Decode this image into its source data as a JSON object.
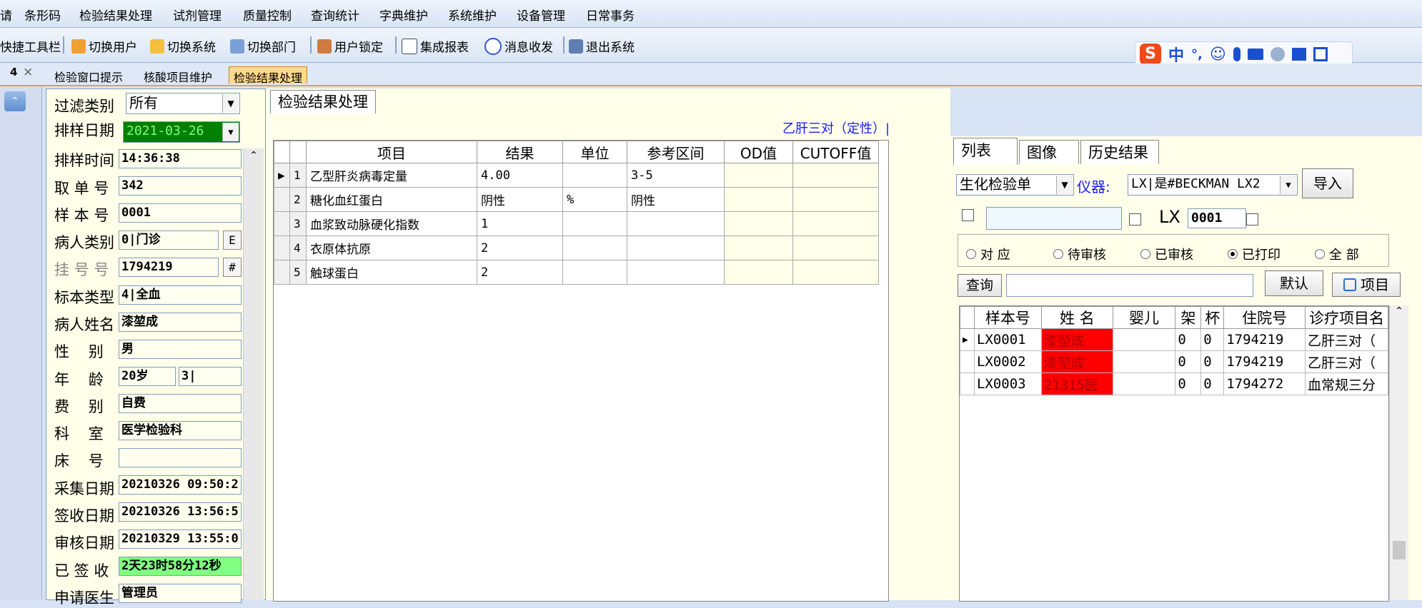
{
  "menu": [
    "请",
    "条形码",
    "检验结果处理",
    "试剂管理",
    "质量控制",
    "查询统计",
    "字典维护",
    "系统维护",
    "设备管理",
    "日常事务"
  ],
  "toolbar": {
    "quick": "快捷工具栏",
    "switch_user": "切换用户",
    "switch_system": "切换系统",
    "switch_dept": "切换部门",
    "user_lock": "用户锁定",
    "report": "集成报表",
    "message": "消息收发",
    "exit": "退出系统"
  },
  "ime": {
    "logo": "S",
    "mode": "中",
    "punct": "°,"
  },
  "doc_tabs": [
    "检验窗口提示",
    "核酸项目维护",
    "检验结果处理"
  ],
  "pin": "4",
  "close": "×",
  "left": {
    "filter_label": "过滤类别",
    "filter_value": "所有",
    "date_label": "排样日期",
    "date_value": "2021-03-26",
    "fields": [
      {
        "label": "排样时间",
        "value": "14:36:38"
      },
      {
        "label": "取 单 号",
        "value": "342"
      },
      {
        "label": "样 本 号",
        "value": "0001"
      },
      {
        "label": "病人类别",
        "value": "0|门诊"
      },
      {
        "label": "挂 号 号",
        "value": "1794219"
      },
      {
        "label": "标本类型",
        "value": "4|全血"
      },
      {
        "label": "病人姓名",
        "value": "漆堃成"
      },
      {
        "label": "性    别",
        "value": "男"
      },
      {
        "label": "年    龄",
        "value": "20岁"
      },
      {
        "label": "费    别",
        "value": "自费"
      },
      {
        "label": "科    室",
        "value": "医学检验科"
      },
      {
        "label": "床    号",
        "value": ""
      },
      {
        "label": "采集日期",
        "value": "20210326 09:50:2"
      },
      {
        "label": "签收日期",
        "value": "20210326 13:56:5"
      },
      {
        "label": "审核日期",
        "value": "20210329 13:55:0"
      },
      {
        "label": "已 签 收",
        "value": "2天23时58分12秒"
      },
      {
        "label": "申请医生",
        "value": "管理员"
      }
    ],
    "age_unit_value": "3|",
    "btn_e": "E",
    "btn_hash": "#"
  },
  "center": {
    "tab": "检验结果处理",
    "title": "乙肝三对（定性）|",
    "columns": [
      "项目",
      "结果",
      "单位",
      "参考区间",
      "OD值",
      "CUTOFF值"
    ],
    "rows": [
      {
        "no": "1",
        "item": "乙型肝炎病毒定量",
        "result": "4.00",
        "unit": "",
        "range": "3-5",
        "od": "",
        "cutoff": ""
      },
      {
        "no": "2",
        "item": "糖化血红蛋白",
        "result": "阴性",
        "unit": "%",
        "range": "阴性",
        "od": "",
        "cutoff": ""
      },
      {
        "no": "3",
        "item": "血浆致动脉硬化指数",
        "result": "1",
        "unit": "",
        "range": "",
        "od": "",
        "cutoff": ""
      },
      {
        "no": "4",
        "item": "衣原体抗原",
        "result": "2",
        "unit": "",
        "range": "",
        "od": "",
        "cutoff": ""
      },
      {
        "no": "5",
        "item": "触球蛋白",
        "result": "2",
        "unit": "",
        "range": "",
        "od": "",
        "cutoff": ""
      }
    ]
  },
  "right": {
    "tabs": [
      "列表",
      "图像",
      "历史结果"
    ],
    "form_type": "生化检验单",
    "instrument_label": "仪器:",
    "instrument_value": "LX|是#BECKMAN LX2",
    "import_btn": "导入",
    "lx_label": "LX",
    "lx_value": "0001",
    "radios": [
      "对 应",
      "待审核",
      "已审核",
      "已打印",
      "全 部"
    ],
    "selected_radio": 3,
    "query_btn": "查询",
    "default_btn": "默认",
    "items_btn": "项目",
    "list_columns": [
      "样本号",
      "姓 名",
      "婴儿",
      "架",
      "杯",
      "住院号",
      "诊疗项目名"
    ],
    "list_rows": [
      {
        "sample": "LX0001",
        "name": "漆堃成",
        "baby": "",
        "rack": "0",
        "cup": "0",
        "inpatient": "1794219",
        "project": "乙肝三对（"
      },
      {
        "sample": "LX0002",
        "name": "漆堃成",
        "baby": "",
        "rack": "0",
        "cup": "0",
        "inpatient": "1794219",
        "project": "乙肝三对（"
      },
      {
        "sample": "LX0003",
        "name": "21315医",
        "baby": "",
        "rack": "0",
        "cup": "0",
        "inpatient": "1794272",
        "project": "血常规三分"
      }
    ]
  },
  "colors": {
    "accent": "#e7a42c",
    "date_bg": "#008000",
    "signed_bg": "#80ff80",
    "name_bg": "#ff0000",
    "title": "#1a1aff"
  }
}
